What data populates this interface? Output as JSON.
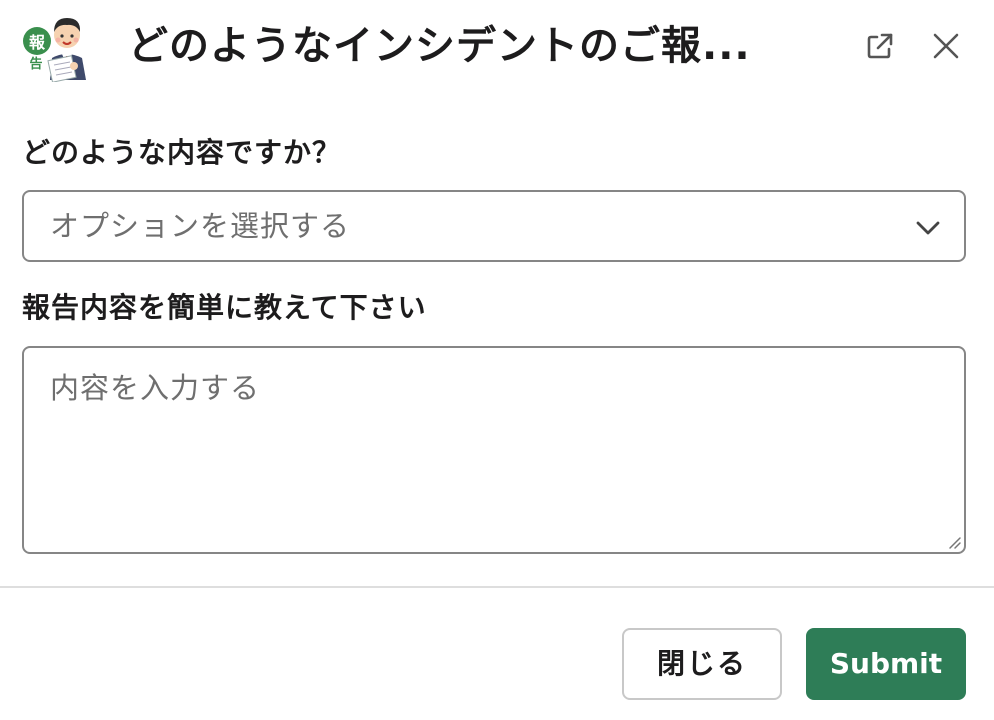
{
  "header": {
    "title": "どのようなインシデントのご報...",
    "badge_top": "報",
    "badge_bottom": "告",
    "popout_icon": "external-link-icon",
    "close_icon": "close-icon"
  },
  "form": {
    "question1_label": "どのような内容ですか？",
    "select_placeholder": "オプションを選択する",
    "question2_label": "報告内容を簡単に教えて下さい",
    "textarea_placeholder": "内容を入力する",
    "textarea_value": ""
  },
  "footer": {
    "close_label": "閉じる",
    "submit_label": "Submit"
  },
  "colors": {
    "primary": "#2e7d57",
    "badge_green": "#3a8f4d",
    "border": "#868686",
    "placeholder": "#6f6f6f"
  }
}
